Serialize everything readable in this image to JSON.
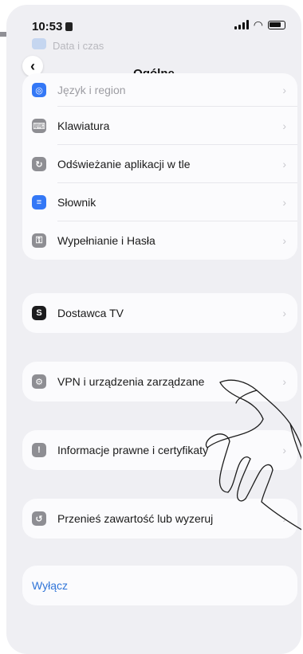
{
  "status": {
    "time": "10:53",
    "battery_level": "60"
  },
  "nav": {
    "title": "Ogólne",
    "back_label": "<"
  },
  "ghost_text": "Data i czas",
  "groups": [
    {
      "items": [
        {
          "label": "Język i region",
          "icon": "globe-icon",
          "icon_color": "#3478f6",
          "faded": true
        },
        {
          "label": "Klawiatura",
          "icon": "keyboard-icon",
          "icon_color": "#8e8e93"
        },
        {
          "label": "Odświeżanie aplikacji w tle",
          "icon": "refresh-icon",
          "icon_color": "#8e8e93"
        },
        {
          "label": "Słownik",
          "icon": "book-icon",
          "icon_color": "#3478f6"
        },
        {
          "label": "Wypełnianie i Hasła",
          "icon": "key-icon",
          "icon_color": "#8e8e93"
        }
      ]
    },
    {
      "items": [
        {
          "label": "Dostawca TV",
          "icon": "tv-provider-icon",
          "icon_color": "#1c1c1e"
        }
      ]
    },
    {
      "items": [
        {
          "label": "VPN i urządzenia zarządzane",
          "icon": "vpn-gear-icon",
          "icon_color": "#8e8e93"
        }
      ]
    },
    {
      "items": [
        {
          "label": "Informacje prawne i certyfikaty",
          "icon": "legal-info-icon",
          "icon_color": "#8e8e93"
        }
      ]
    },
    {
      "items": [
        {
          "label": "Przenieś zawartość lub wyzeruj",
          "icon": "reset-icon",
          "icon_color": "#8e8e93"
        }
      ]
    }
  ],
  "shutdown": {
    "label": "Wyłącz",
    "color": "#2f74d8"
  }
}
